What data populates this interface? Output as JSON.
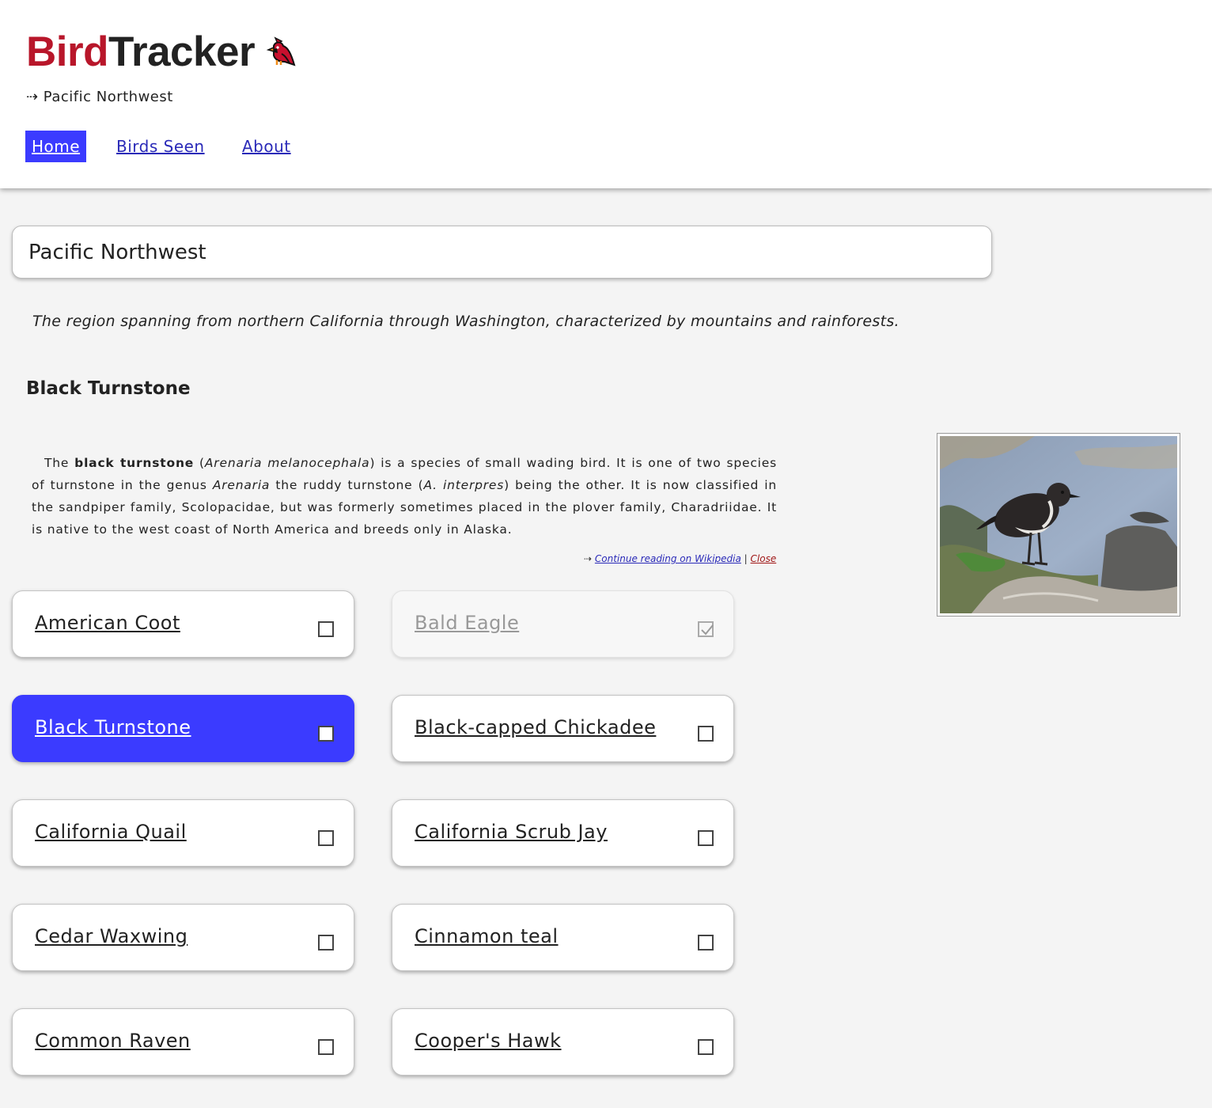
{
  "app": {
    "title_part1": "Bird",
    "title_part2": "Tracker",
    "logo_icon": "cardinal-icon",
    "region_crumb": "⇢ Pacific Northwest",
    "brand_colors": {
      "bird": "#b8162a",
      "accent": "#3b3bff",
      "link": "#2a2ab8"
    }
  },
  "nav": [
    {
      "label": "Home",
      "active": true
    },
    {
      "label": "Birds Seen",
      "active": false
    },
    {
      "label": "About",
      "active": false
    }
  ],
  "region": {
    "value": "Pacific Northwest",
    "description": "The region spanning from northern California through Washington, characterized by mountains and rainforests."
  },
  "selected_bird": {
    "heading": "Black Turnstone",
    "summary": {
      "p1": "The ",
      "p2": "black turnstone",
      "p3": " (",
      "p4": "Arenaria melanocephala",
      "p5": ") is a species of small wading bird. It is one of two species of turnstone in the genus ",
      "p6": "Arenaria",
      "p7": " the ruddy turnstone (",
      "p8": "A. interpres",
      "p9": ") being the other. It is now classified in the sandpiper family, Scolopacidae, but was formerly sometimes placed in the plover family, Charadriidae. It is native to the west coast of North America and breeds only in Alaska."
    },
    "continue_prefix": "⇢ ",
    "continue_label": "Continue reading on Wikipedia",
    "separator": " | ",
    "close_label": "Close"
  },
  "birds": [
    {
      "name": "American Coot",
      "seen": false,
      "selected": false
    },
    {
      "name": "Bald Eagle",
      "seen": true,
      "selected": false
    },
    {
      "name": "Black Turnstone",
      "seen": false,
      "selected": true
    },
    {
      "name": "Black-capped Chickadee",
      "seen": false,
      "selected": false
    },
    {
      "name": "California Quail",
      "seen": false,
      "selected": false
    },
    {
      "name": "California Scrub Jay",
      "seen": false,
      "selected": false
    },
    {
      "name": "Cedar Waxwing",
      "seen": false,
      "selected": false
    },
    {
      "name": "Cinnamon teal",
      "seen": false,
      "selected": false
    },
    {
      "name": "Common Raven",
      "seen": false,
      "selected": false
    },
    {
      "name": "Cooper's Hawk",
      "seen": false,
      "selected": false
    }
  ]
}
